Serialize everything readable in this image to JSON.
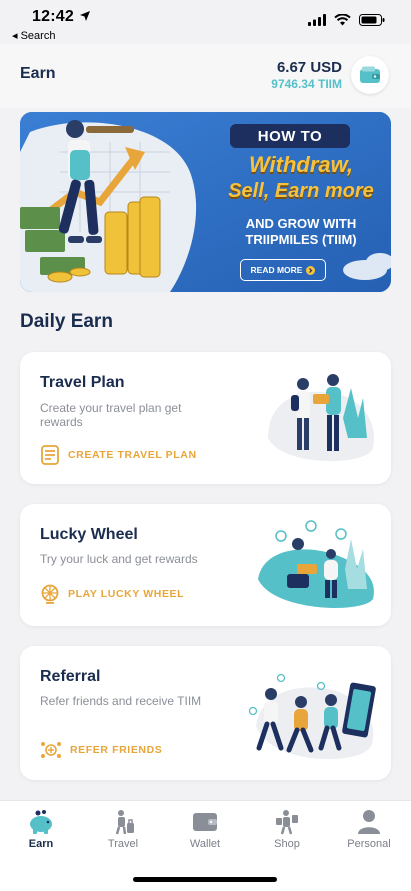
{
  "status_bar": {
    "time": "12:42",
    "back_label": "◂ Search"
  },
  "header": {
    "title": "Earn",
    "balance_usd": "6.67 USD",
    "balance_tiim": "9746.34 TIIM"
  },
  "banner": {
    "badge": "HOW TO",
    "line1": "Withdraw,",
    "line2": "Sell, Earn more",
    "line3": "AND GROW WITH",
    "line4": "TRIIPMILES (TIIM)",
    "button": "READ MORE"
  },
  "section_title": "Daily Earn",
  "cards": [
    {
      "title": "Travel Plan",
      "description": "Create your travel plan get rewards",
      "action": "CREATE TRAVEL PLAN"
    },
    {
      "title": "Lucky Wheel",
      "description": "Try your luck and get rewards",
      "action": "PLAY LUCKY WHEEL"
    },
    {
      "title": "Referral",
      "description": "Refer friends and receive TIIM",
      "action": "REFER FRIENDS"
    }
  ],
  "tabs": [
    {
      "label": "Earn",
      "icon": "piggy-bank-icon",
      "active": true
    },
    {
      "label": "Travel",
      "icon": "traveler-icon",
      "active": false
    },
    {
      "label": "Wallet",
      "icon": "wallet-icon",
      "active": false
    },
    {
      "label": "Shop",
      "icon": "shopping-icon",
      "active": false
    },
    {
      "label": "Personal",
      "icon": "person-icon",
      "active": false
    }
  ],
  "colors": {
    "accent": "#55c0c8",
    "navy": "#1b2d4f",
    "action": "#e8a63a",
    "banner_bg": "#2d6fc4"
  }
}
